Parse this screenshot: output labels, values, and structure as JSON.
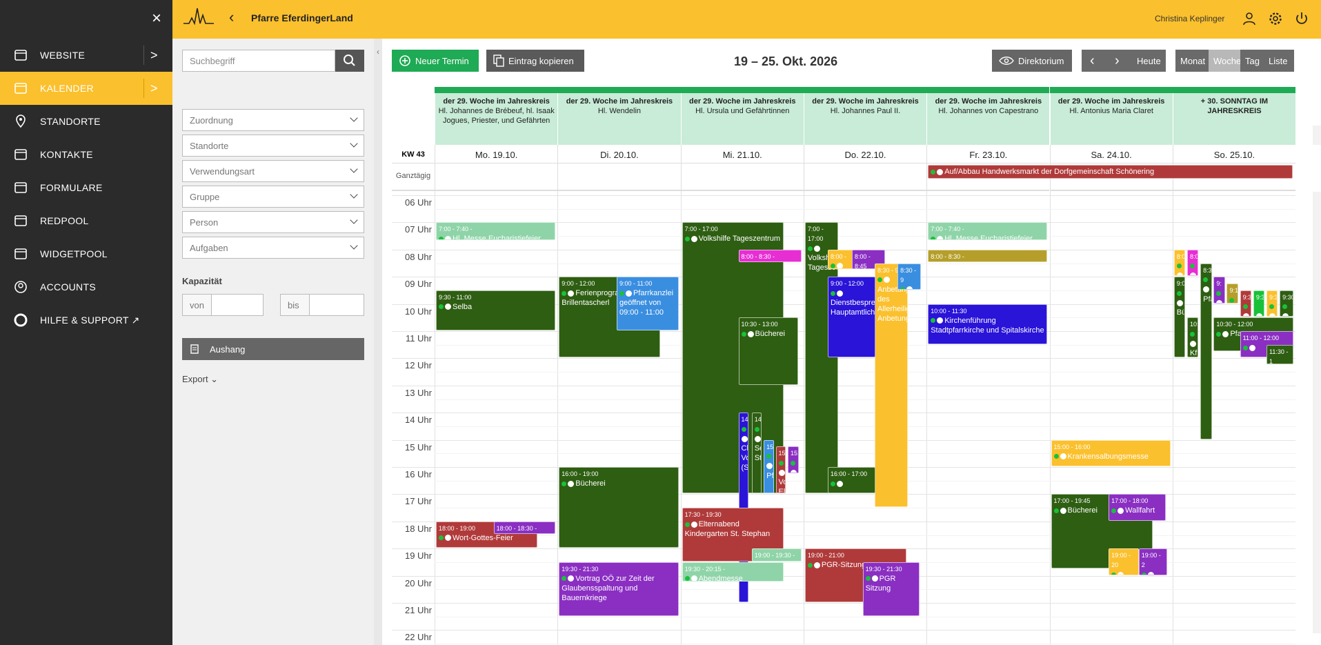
{
  "nav": {
    "items": [
      {
        "label": "WEBSITE",
        "icon": "website-icon",
        "chevron": ">"
      },
      {
        "label": "KALENDER",
        "icon": "calendar-icon",
        "chevron": ">",
        "active": true
      },
      {
        "label": "STANDORTE",
        "icon": "location-pin-icon"
      },
      {
        "label": "KONTAKTE",
        "icon": "contacts-icon"
      },
      {
        "label": "FORMULARE",
        "icon": "form-icon"
      },
      {
        "label": "REDPOOL",
        "icon": "redpool-icon"
      },
      {
        "label": "WIDGETPOOL",
        "icon": "widgetpool-icon"
      },
      {
        "label": "ACCOUNTS",
        "icon": "account-icon"
      },
      {
        "label": "HILFE & SUPPORT",
        "icon": "lifebuoy-icon",
        "suffix": "↗"
      }
    ],
    "close": "×"
  },
  "topbar": {
    "back": "‹",
    "parish": "Pfarre EferdingerLand",
    "user": "Christina Keplinger"
  },
  "filters": {
    "search_placeholder": "Suchbegriff",
    "selects": [
      "Zuordnung",
      "Standorte",
      "Verwendungsart",
      "Gruppe",
      "Person",
      "Aufgaben"
    ],
    "capacity_label": "Kapazität",
    "from": "von",
    "to": "bis",
    "aushang": "Aushang",
    "export": "Export ⌄"
  },
  "toolbar": {
    "new_event": "Neuer Termin",
    "copy_entry": "Eintrag kopieren",
    "week_title": "19 – 25. Okt. 2026",
    "directory": "Direktorium",
    "prev": "‹",
    "next": "›",
    "today": "Heute",
    "views": [
      "Monat",
      "Woche",
      "Tag",
      "Liste"
    ],
    "active_view": "Woche"
  },
  "calendar": {
    "week_label": "KW 43",
    "allday_label": "Ganztägig",
    "days": [
      {
        "liturgy": "der 29. Woche im Jahreskreis",
        "saint": "Hl. Johannes de Brébeuf, hl. Isaak Jogues, Priester, und Gefährten",
        "date": "Mo. 19.10."
      },
      {
        "liturgy": "der 29. Woche im Jahreskreis",
        "saint": "Hl. Wendelin",
        "date": "Di. 20.10."
      },
      {
        "liturgy": "der 29. Woche im Jahreskreis",
        "saint": "Hl. Ursula und Gefährtinnen",
        "date": "Mi. 21.10."
      },
      {
        "liturgy": "der 29. Woche im Jahreskreis",
        "saint": "Hl. Johannes Paul II.",
        "date": "Do. 22.10."
      },
      {
        "liturgy": "der 29. Woche im Jahreskreis",
        "saint": "Hl. Johannes von Capestrano",
        "date": "Fr. 23.10."
      },
      {
        "liturgy": "der 29. Woche im Jahreskreis",
        "saint": "Hl. Antonius Maria Claret",
        "date": "Sa. 24.10."
      },
      {
        "liturgy": "+ 30. SONNTAG IM JAHRESKREIS",
        "saint": "",
        "date": "So. 25.10."
      }
    ],
    "hours": [
      "06 Uhr",
      "07 Uhr",
      "08 Uhr",
      "09 Uhr",
      "10 Uhr",
      "11 Uhr",
      "12 Uhr",
      "13 Uhr",
      "14 Uhr",
      "15 Uhr",
      "16 Uhr",
      "17 Uhr",
      "18 Uhr",
      "19 Uhr",
      "20 Uhr",
      "21 Uhr",
      "22 Uhr"
    ],
    "allday_event": "Auf/Abbau Handwerksmarkt der Dorfgemeinschaft Schönering",
    "events": [
      {
        "day": 0,
        "start": 7.0,
        "end": 7.67,
        "time": "7:00 - 7:40 -",
        "name": "Hl. Messe Eucharistiefeier",
        "color": "c-lg",
        "col": 0,
        "w": 1
      },
      {
        "day": 0,
        "start": 9.5,
        "end": 11.0,
        "time": "9:30 - 11:00",
        "name": "Selba",
        "color": "c-dg",
        "col": 0,
        "w": 1
      },
      {
        "day": 0,
        "start": 18.0,
        "end": 19.0,
        "time": "18:00 - 19:00",
        "name": "Wort-Gottes-Feier",
        "color": "c-rd",
        "col": 0,
        "w": 0.85
      },
      {
        "day": 0,
        "start": 18.0,
        "end": 18.5,
        "time": "18:00 - 18:30 -",
        "name": "",
        "color": "c-pu",
        "col": 0.48,
        "w": 0.52
      },
      {
        "day": 1,
        "start": 9.0,
        "end": 12.0,
        "time": "9:00 - 12:00",
        "name": "Ferienprogramm - Brillentascherl",
        "color": "c-dg",
        "col": 0,
        "w": 0.85
      },
      {
        "day": 1,
        "start": 9.0,
        "end": 11.0,
        "time": "9:00 - 11:00",
        "name": "Pfarrkanzlei geöffnet von 09:00 - 11:00",
        "color": "c-bl",
        "col": 0.48,
        "w": 0.52
      },
      {
        "day": 1,
        "start": 16.0,
        "end": 19.0,
        "time": "16:00 - 19:00",
        "name": "Bücherei",
        "color": "c-dg",
        "col": 0,
        "w": 1
      },
      {
        "day": 1,
        "start": 19.5,
        "end": 21.5,
        "time": "19:30 - 21:30",
        "name": "Vortrag OÖ zur Zeit der Glaubensspaltung und Bauernkriege",
        "color": "c-pu",
        "col": 0,
        "w": 1
      },
      {
        "day": 2,
        "start": 7.0,
        "end": 17.0,
        "time": "7:00 - 17:00",
        "name": "Volkshilfe Tageszentrum",
        "color": "c-dg",
        "col": 0,
        "w": 0.85
      },
      {
        "day": 2,
        "start": 8.0,
        "end": 8.5,
        "time": "8:00 - 8:30 -",
        "name": "",
        "color": "c-pk",
        "col": 0.47,
        "w": 0.53
      },
      {
        "day": 2,
        "start": 10.5,
        "end": 13.0,
        "time": "10:30 - 13:00",
        "name": "Bücherei",
        "color": "c-dg",
        "col": 0.47,
        "w": 0.5
      },
      {
        "day": 2,
        "start": 14.0,
        "end": 21.0,
        "time": "14",
        "name": "Cl Vo (S",
        "color": "c-in",
        "col": 0.47,
        "w": 0.09
      },
      {
        "day": 2,
        "start": 14.0,
        "end": 17.0,
        "time": "14",
        "name": "Se St",
        "color": "c-dg",
        "col": 0.58,
        "w": 0.09
      },
      {
        "day": 2,
        "start": 15.0,
        "end": 17.0,
        "time": "15",
        "name": "Pf",
        "color": "c-bl",
        "col": 0.68,
        "w": 0.09
      },
      {
        "day": 2,
        "start": 15.25,
        "end": 17.0,
        "time": "15",
        "name": "Vo El",
        "color": "c-rd",
        "col": 0.78,
        "w": 0.09
      },
      {
        "day": 2,
        "start": 15.25,
        "end": 16.25,
        "time": "15:",
        "name": "",
        "color": "c-pu",
        "col": 0.88,
        "w": 0.1
      },
      {
        "day": 2,
        "start": 17.5,
        "end": 19.5,
        "time": "17:30 - 19:30",
        "name": "Elternabend Kindergarten St. Stephan",
        "color": "c-rd",
        "col": 0,
        "w": 0.85
      },
      {
        "day": 2,
        "start": 19.0,
        "end": 19.5,
        "time": "19:00 - 19:30 -",
        "name": "",
        "color": "c-lg",
        "col": 0.58,
        "w": 0.42
      },
      {
        "day": 2,
        "start": 19.5,
        "end": 20.25,
        "time": "19:30 - 20:15 -",
        "name": "Abendmesse",
        "color": "c-lg",
        "col": 0,
        "w": 0.85
      },
      {
        "day": 3,
        "start": 7.0,
        "end": 17.0,
        "time": "7:00 - 17:00",
        "name": "Volkshilfe Tageszentrum",
        "color": "c-dg",
        "col": 0,
        "w": 0.28
      },
      {
        "day": 3,
        "start": 8.0,
        "end": 8.75,
        "time": "8:00 -",
        "name": "",
        "color": "c-yl",
        "col": 0.19,
        "w": 0.22
      },
      {
        "day": 3,
        "start": 8.0,
        "end": 8.75,
        "time": "8:00 - 8:45",
        "name": "",
        "color": "c-pu",
        "col": 0.39,
        "w": 0.28
      },
      {
        "day": 3,
        "start": 8.5,
        "end": 17.5,
        "time": "8:30 - 9",
        "name": "Anbetung des Allerheiligsten Anbetung",
        "color": "c-yl",
        "col": 0.58,
        "w": 0.28
      },
      {
        "day": 3,
        "start": 8.5,
        "end": 9.5,
        "time": "8:30 - 9",
        "name": "",
        "color": "c-bl",
        "col": 0.77,
        "w": 0.2
      },
      {
        "day": 3,
        "start": 9.0,
        "end": 12.0,
        "time": "9:00 - 12:00",
        "name": "Dienstbesprechung Hauptamtliche",
        "color": "c-in",
        "col": 0.19,
        "w": 0.4
      },
      {
        "day": 3,
        "start": 16.0,
        "end": 17.0,
        "time": "16:00 - 17:00",
        "name": "",
        "color": "c-dg",
        "col": 0.19,
        "w": 0.4
      },
      {
        "day": 3,
        "start": 19.0,
        "end": 21.0,
        "time": "19:00 - 21:00",
        "name": "PGR-Sitzung",
        "color": "c-rd",
        "col": 0,
        "w": 0.85
      },
      {
        "day": 3,
        "start": 19.5,
        "end": 21.5,
        "time": "19:30 - 21:30",
        "name": "PGR Sitzung",
        "color": "c-pu",
        "col": 0.48,
        "w": 0.48
      },
      {
        "day": 4,
        "start": 7.0,
        "end": 7.67,
        "time": "7:00 - 7:40 -",
        "name": "Hl. Messe Eucharistiefeier",
        "color": "c-lg",
        "col": 0,
        "w": 1
      },
      {
        "day": 4,
        "start": 8.0,
        "end": 8.5,
        "time": "8:00 - 8:30 -",
        "name": "",
        "color": "c-ol",
        "col": 0,
        "w": 1
      },
      {
        "day": 4,
        "start": 10.0,
        "end": 11.5,
        "time": "10:00 - 11:30",
        "name": "Kirchenführung Stadtpfarrkirche und Spitalskirche",
        "color": "c-in",
        "col": 0,
        "w": 1
      },
      {
        "day": 5,
        "start": 15.0,
        "end": 16.0,
        "time": "15:00 - 16:00",
        "name": "Krankensalbungsmesse",
        "color": "c-yl",
        "col": 0,
        "w": 1
      },
      {
        "day": 5,
        "start": 17.0,
        "end": 19.75,
        "time": "17:00 - 19:45",
        "name": "Bücherei",
        "color": "c-dg",
        "col": 0,
        "w": 0.85
      },
      {
        "day": 5,
        "start": 17.0,
        "end": 18.0,
        "time": "17:00 - 18:00",
        "name": "Wallfahrt",
        "color": "c-pu",
        "col": 0.48,
        "w": 0.48
      },
      {
        "day": 5,
        "start": 19.0,
        "end": 20.0,
        "time": "19:00 - 20",
        "name": "",
        "color": "c-yl",
        "col": 0.48,
        "w": 0.26
      },
      {
        "day": 5,
        "start": 19.0,
        "end": 20.0,
        "time": "19:00 - 2",
        "name": "",
        "color": "c-pu",
        "col": 0.73,
        "w": 0.24
      },
      {
        "day": 6,
        "start": 8.0,
        "end": 9.0,
        "time": "8:0",
        "name": "",
        "color": "c-yl",
        "col": 0,
        "w": 0.1
      },
      {
        "day": 6,
        "start": 8.0,
        "end": 9.0,
        "time": "8:0",
        "name": "",
        "color": "c-pk",
        "col": 0.11,
        "w": 0.1
      },
      {
        "day": 6,
        "start": 8.5,
        "end": 15.0,
        "time": "8:3",
        "name": "Pfa",
        "color": "c-dg",
        "col": 0.22,
        "w": 0.1
      },
      {
        "day": 6,
        "start": 9.0,
        "end": 12.0,
        "time": "9:0",
        "name": "Bü",
        "color": "c-dg",
        "col": 0,
        "w": 0.1
      },
      {
        "day": 6,
        "start": 9.0,
        "end": 10.0,
        "time": "9:",
        "name": "",
        "color": "c-pu",
        "col": 0.33,
        "w": 0.1
      },
      {
        "day": 6,
        "start": 9.25,
        "end": 10.0,
        "time": "9:1",
        "name": "",
        "color": "c-ol",
        "col": 0.44,
        "w": 0.1
      },
      {
        "day": 6,
        "start": 9.5,
        "end": 10.5,
        "time": "9:3",
        "name": "",
        "color": "c-rd",
        "col": 0.55,
        "w": 0.1
      },
      {
        "day": 6,
        "start": 9.5,
        "end": 10.5,
        "time": "9:3",
        "name": "",
        "color": "c-gr",
        "col": 0.66,
        "w": 0.1
      },
      {
        "day": 6,
        "start": 9.5,
        "end": 10.5,
        "time": "9:3",
        "name": "",
        "color": "c-yl",
        "col": 0.77,
        "w": 0.1
      },
      {
        "day": 6,
        "start": 9.5,
        "end": 10.5,
        "time": "9:30",
        "name": "",
        "color": "c-dg",
        "col": 0.88,
        "w": 0.12
      },
      {
        "day": 6,
        "start": 10.5,
        "end": 12.0,
        "time": "10:",
        "name": "Kfi",
        "color": "c-dg",
        "col": 0.11,
        "w": 0.1
      },
      {
        "day": 6,
        "start": 10.5,
        "end": 11.75,
        "time": "10:30 - 12:00",
        "name": "Pfarrca",
        "color": "c-dg",
        "col": 0.33,
        "w": 0.67
      },
      {
        "day": 6,
        "start": 11.0,
        "end": 12.0,
        "time": "11:00 - 12:00",
        "name": "",
        "color": "c-pu",
        "col": 0.55,
        "w": 0.45
      },
      {
        "day": 6,
        "start": 11.5,
        "end": 12.25,
        "time": "11:30 - 1",
        "name": "",
        "color": "c-dg",
        "col": 0.77,
        "w": 0.23
      }
    ]
  }
}
